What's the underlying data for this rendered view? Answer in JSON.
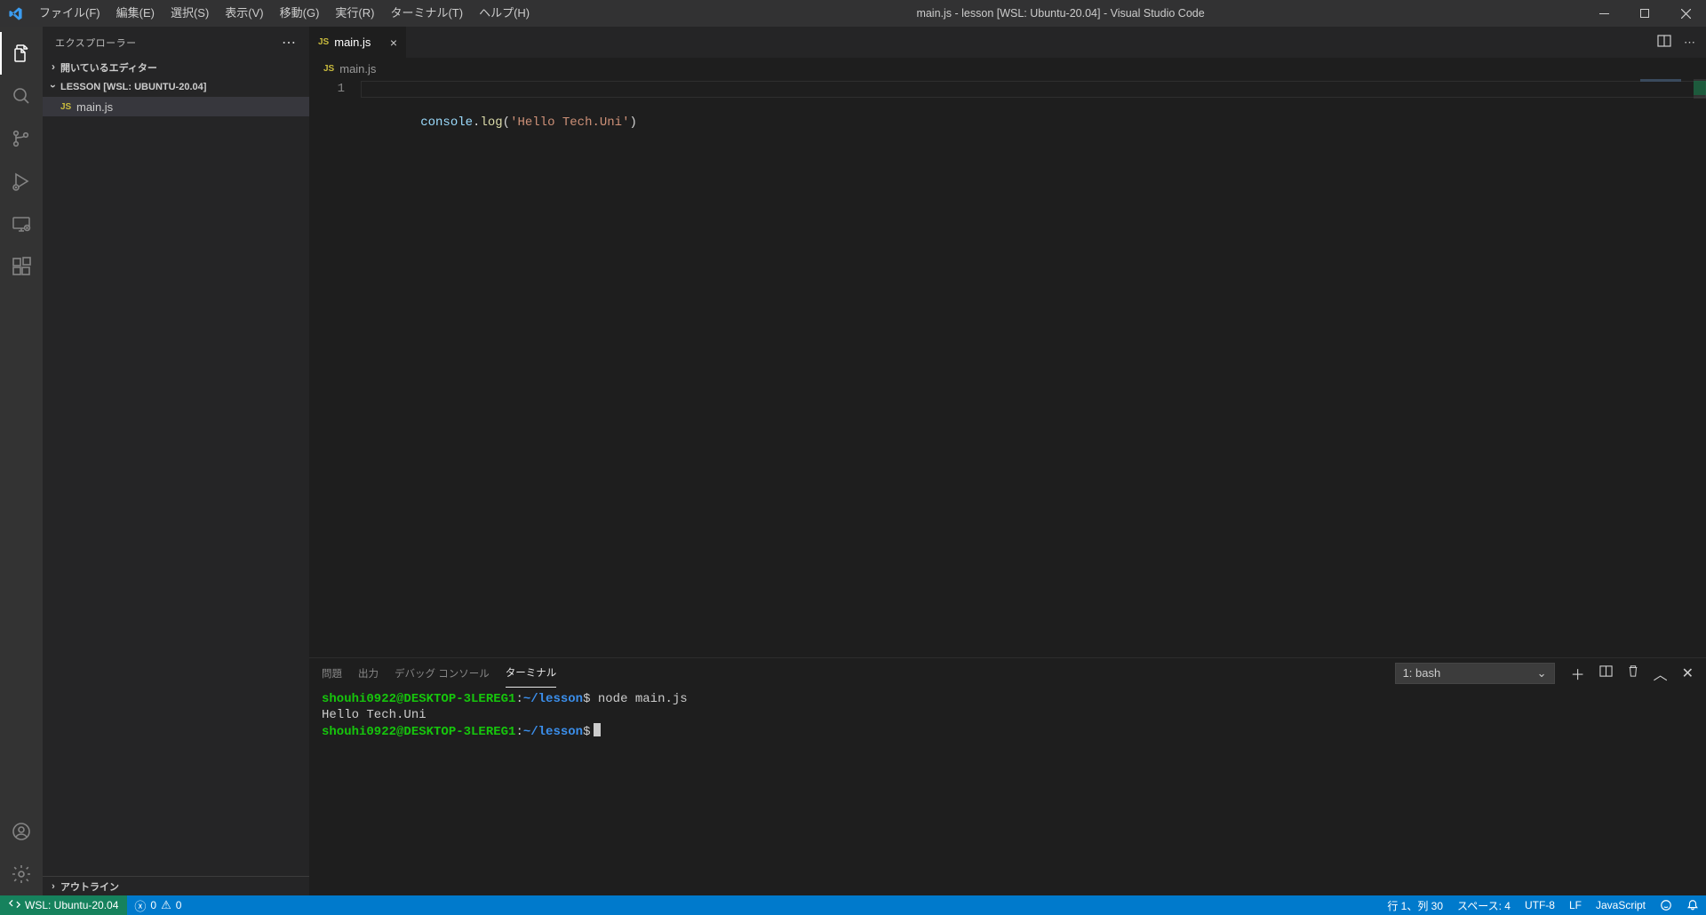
{
  "window": {
    "title": "main.js - lesson [WSL: Ubuntu-20.04] - Visual Studio Code"
  },
  "menubar": {
    "file": "ファイル(F)",
    "edit": "編集(E)",
    "select": "選択(S)",
    "view": "表示(V)",
    "go": "移動(G)",
    "run": "実行(R)",
    "terminal": "ターミナル(T)",
    "help": "ヘルプ(H)"
  },
  "sidebar": {
    "title": "エクスプローラー",
    "open_editors": "開いているエディター",
    "workspace": "LESSON [WSL: UBUNTU-20.04]",
    "file_icon": "JS",
    "file_name": "main.js",
    "outline": "アウトライン"
  },
  "editor": {
    "tab_icon": "JS",
    "tab_label": "main.js",
    "breadcrumb_icon": "JS",
    "breadcrumb": "main.js",
    "line_no": "1",
    "code": {
      "obj": "console",
      "dot": ".",
      "fn": "log",
      "lparen": "(",
      "str": "'Hello Tech.Uni'",
      "rparen": ")"
    }
  },
  "panel": {
    "tabs": {
      "problems": "問題",
      "output": "出力",
      "debug": "デバッグ コンソール",
      "terminal": "ターミナル"
    },
    "select_label": "1: bash",
    "prompt": {
      "user": "shouhi0922@DESKTOP-3LEREG1",
      "colon": ":",
      "path": "~/lesson",
      "dollar": "$"
    },
    "command": "node main.js",
    "output": "Hello Tech.Uni"
  },
  "status": {
    "remote_label": "WSL: Ubuntu-20.04",
    "errors": "0",
    "warnings": "0",
    "cursor": "行 1、列 30",
    "spaces": "スペース: 4",
    "encoding": "UTF-8",
    "eol": "LF",
    "lang": "JavaScript"
  }
}
